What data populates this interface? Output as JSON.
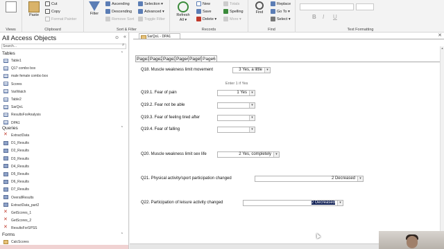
{
  "ribbon": {
    "views": {
      "view_label": "View",
      "group": "Views"
    },
    "clipboard": {
      "paste": "Paste",
      "cut": "Cut",
      "copy": "Copy",
      "format_painter": "Format Painter",
      "group": "Clipboard"
    },
    "sort_filter": {
      "filter": "Filter",
      "ascending": "Ascending",
      "descending": "Descending",
      "remove_sort": "Remove Sort",
      "selection": "Selection",
      "advanced": "Advanced",
      "toggle_filter": "Toggle Filter",
      "group": "Sort & Filter"
    },
    "records": {
      "refresh": "Refresh All",
      "new": "New",
      "save": "Save",
      "delete": "Delete",
      "totals": "Totals",
      "spelling": "Spelling",
      "more": "More",
      "group": "Records"
    },
    "find": {
      "find": "Find",
      "replace": "Replace",
      "goto": "Go To",
      "select": "Select",
      "group": "Find"
    },
    "text_formatting": {
      "group": "Text Formatting",
      "bold": "B",
      "italic": "I",
      "underline": "U"
    }
  },
  "nav": {
    "title": "All Access Objects",
    "search_placeholder": "Search...",
    "sections": {
      "tables": "Tables",
      "queries": "Queries",
      "forms": "Forms"
    },
    "tables": [
      "Table1",
      "Q17 combo box",
      "male female combo box",
      "Scores",
      "VarWatch",
      "Table2",
      "SarQoL",
      "ResultsForAnalysis",
      "DPA1"
    ],
    "queries": [
      "ExtractData",
      "D1_Results",
      "D2_Results",
      "D3_Results",
      "D4_Results",
      "D5_Results",
      "D6_Results",
      "D7_Results",
      "OverallResults",
      "ExtractData_part2",
      "GetScores_1",
      "GetScores_2",
      "ResultsForSPSS"
    ],
    "forms": [
      "CalcScores"
    ]
  },
  "document": {
    "tab_label": "SarQoL - DPA1",
    "page_tabs": [
      "Page1",
      "Page2",
      "Page3",
      "Page4",
      "Page5",
      "Page6"
    ],
    "active_page": "Page6",
    "enter_hint": "Enter 1 if Yes",
    "questions": [
      {
        "id": "q18",
        "label": "Q18. Muscle weakness limit movement",
        "value": "3 Yes, a little"
      },
      {
        "id": "q19_1",
        "label": "Q19.1. Fear of pain",
        "value": "1 Yes"
      },
      {
        "id": "q19_2",
        "label": "Q19.2. Fear not be able",
        "value": ""
      },
      {
        "id": "q19_3",
        "label": "Q19.3. Fear of feeling tired after",
        "value": ""
      },
      {
        "id": "q19_4",
        "label": "Q19.4. Fear of falling",
        "value": ""
      },
      {
        "id": "q20",
        "label": "Q20. Muscle weakness limit sex life",
        "value": "2 Yes, completely"
      },
      {
        "id": "q21",
        "label": "Q21. Physical activity/sport participation changed",
        "value": "2 Decreased"
      },
      {
        "id": "q22",
        "label": "Q22. Participation of leisure activity changed",
        "value": "2 Decreased"
      }
    ]
  },
  "colors": {
    "accent": "#a4373a",
    "selection": "#0e1e54"
  }
}
